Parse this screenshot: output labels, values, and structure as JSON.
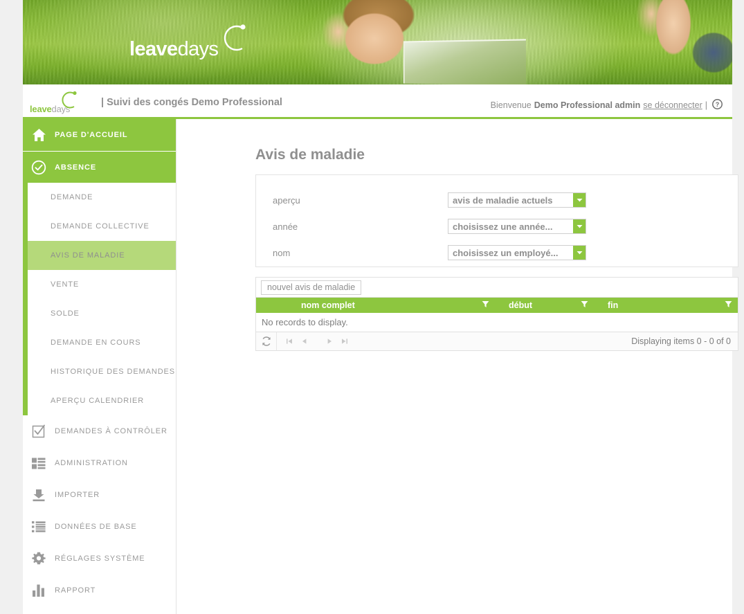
{
  "brand": {
    "logo_leave": "leave",
    "logo_days": "days",
    "accent_green": "#8dc63f",
    "light_green": "#b5d97a",
    "grey_text": "#8f8f8f"
  },
  "subheader": {
    "title": "| Suivi des congés Demo Professional",
    "welcome_prefix": "Bienvenue",
    "user_name": "Demo Professional admin",
    "logout_label": "se déconnecter",
    "separator": "|",
    "help_icon": "help-circle-icon"
  },
  "sidebar": {
    "main_items": [
      {
        "label": "PAGE D'ACCUEIL",
        "icon": "home-icon"
      },
      {
        "label": "ABSENCE",
        "icon": "check-circle-icon"
      }
    ],
    "sub_items": [
      {
        "label": "DEMANDE",
        "active": false
      },
      {
        "label": "DEMANDE COLLECTIVE",
        "active": false
      },
      {
        "label": "AVIS DE MALADIE",
        "active": true
      },
      {
        "label": "VENTE",
        "active": false
      },
      {
        "label": "SOLDE",
        "active": false
      },
      {
        "label": "DEMANDE EN COURS",
        "active": false
      },
      {
        "label": "HISTORIQUE DES DEMANDES",
        "active": false
      },
      {
        "label": "APERÇU CALENDRIER",
        "active": false
      }
    ],
    "lower_items": [
      {
        "label": "DEMANDES À CONTRÔLER",
        "icon": "checkbox-icon"
      },
      {
        "label": "ADMINISTRATION",
        "icon": "admin-bars-icon"
      },
      {
        "label": "IMPORTER",
        "icon": "import-arrow-icon"
      },
      {
        "label": "DONNÉES DE BASE",
        "icon": "list-icon"
      },
      {
        "label": "RÉGLAGES SYSTÈME",
        "icon": "gear-icon"
      },
      {
        "label": "RAPPORT",
        "icon": "bar-chart-icon"
      }
    ]
  },
  "main": {
    "page_title": "Avis de maladie",
    "filters": [
      {
        "label": "aperçu",
        "value": "avis de maladie actuels"
      },
      {
        "label": "année",
        "value": "choisissez une année..."
      },
      {
        "label": "nom",
        "value": "choisissez un employé..."
      }
    ],
    "grid": {
      "new_button_label": "nouvel avis de maladie",
      "columns": [
        {
          "label": "nom complet",
          "filter_icon": "filter-funnel-icon"
        },
        {
          "label": "début",
          "filter_icon": "filter-funnel-icon"
        },
        {
          "label": "fin",
          "filter_icon": "filter-funnel-icon"
        }
      ],
      "empty_message": "No records to display.",
      "refresh_icon": "refresh-icon",
      "pager": {
        "first": "first-page-icon",
        "prev": "prev-page-icon",
        "next": "next-page-icon",
        "last": "last-page-icon"
      },
      "status": "Displaying items 0 - 0 of 0"
    }
  }
}
